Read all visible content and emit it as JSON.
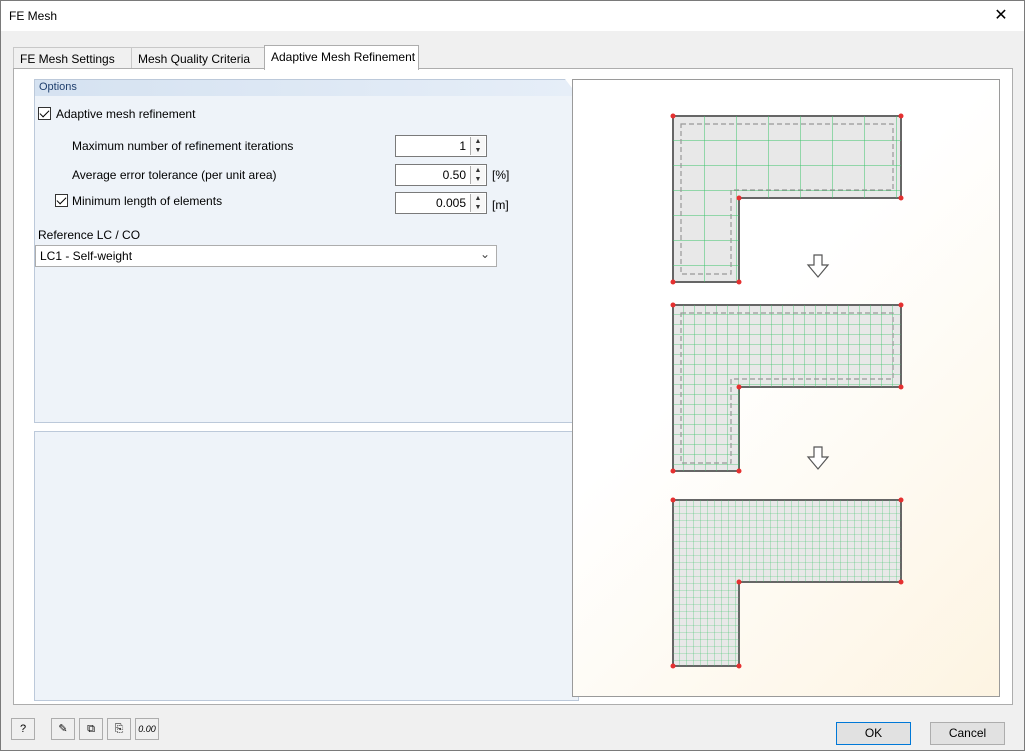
{
  "window": {
    "title": "FE Mesh",
    "close_glyph": "✕"
  },
  "tabs": [
    {
      "label": "FE Mesh Settings"
    },
    {
      "label": "Mesh Quality Criteria"
    },
    {
      "label": "Adaptive Mesh Refinement",
      "active": true
    }
  ],
  "options": {
    "header": "Options",
    "adaptive": {
      "label": "Adaptive mesh refinement",
      "checked": true
    },
    "max_iterations": {
      "label": "Maximum number of refinement iterations",
      "value": "1"
    },
    "avg_error": {
      "label": "Average error tolerance (per unit area)",
      "value": "0.50",
      "unit": "[%]"
    },
    "min_length": {
      "label": "Minimum length of elements",
      "checked": true,
      "value": "0.005",
      "unit": "[m]"
    },
    "reference": {
      "label": "Reference LC / CO",
      "value": "LC1 - Self-weight"
    }
  },
  "footer": {
    "tools": [
      "help-icon",
      "edit-icon",
      "copy-icon",
      "paste-icon",
      "decimals-icon"
    ],
    "decimals_text": "0.00",
    "ok_label": "OK",
    "cancel_label": "Cancel"
  },
  "colors": {
    "mesh": "#3cc46a",
    "node": "#e53030",
    "panel_header": "#1f3f6e",
    "ok_border": "#0078d7"
  }
}
